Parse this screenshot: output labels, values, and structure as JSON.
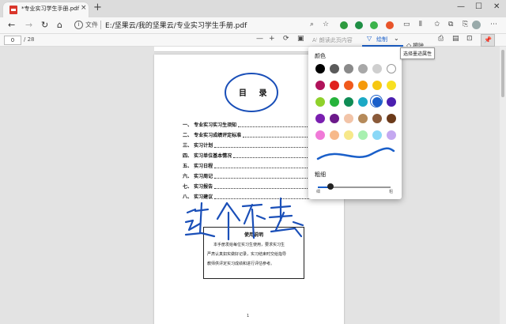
{
  "browser": {
    "tab_title": "*专业实习学生手册.pdf",
    "tab_close": "×",
    "new_tab": "+",
    "win_min": "—",
    "win_max": "☐",
    "win_close": "✕",
    "back": "←",
    "forward": "→",
    "refresh": "↻",
    "home": "⌂",
    "file_label": "文件",
    "url": "E:/坚果云/我的坚果云/专业实习学生手册.pdf"
  },
  "pdf_toolbar": {
    "page_current": "0",
    "page_total": "/ 28",
    "zoom_out": "—",
    "zoom_in": "+",
    "read_aloud": "A⁾ 朗读此页内容",
    "draw_label": "绘制",
    "erase_label": "擦除",
    "tooltip": "选择墨迹属性"
  },
  "document": {
    "toc_title": "目 录",
    "toc_items": [
      "一、 专业实习实习生须知",
      "二、 专业实习成绩评定标准",
      "三、 实习计划",
      "四、 实习单位基本情况",
      "五、 实习日程",
      "六、 实习周记",
      "七、 实习报告",
      "八、 实习建议"
    ],
    "notes_title": "使用说明",
    "notes_lines": [
      "本手册发给每位实习生使用，要求实习生",
      "严肃认真如实做好记录，实习结束时交给指导",
      "教师供评定实习成绩和进行评估参考。"
    ],
    "page_number": "1"
  },
  "ink_panel": {
    "color_label": "颜色",
    "thickness_label": "粗细",
    "thin_label": "细",
    "thick_label": "粗",
    "selected_color": "#1a5fc9",
    "colors": [
      "#000000",
      "#5a5a5a",
      "#8a8a8a",
      "#a8a8a8",
      "#cfcfcf",
      "#ffffff",
      "#b0125a",
      "#e0201e",
      "#f05a1c",
      "#f59a0b",
      "#f6c711",
      "#f8e021",
      "#8fd12b",
      "#26b33b",
      "#0f8c55",
      "#1ba9c5",
      "#1a5fc9",
      "#4b1fb0",
      "#7a1fb0",
      "#6b1a8a",
      "#f2c4a8",
      "#b58a5a",
      "#8a5a3a",
      "#6b3a1a",
      "#f07ad8",
      "#f7b98a",
      "#f7e88a",
      "#a8f0b0",
      "#8ad8f7",
      "#c4a8f0"
    ]
  }
}
